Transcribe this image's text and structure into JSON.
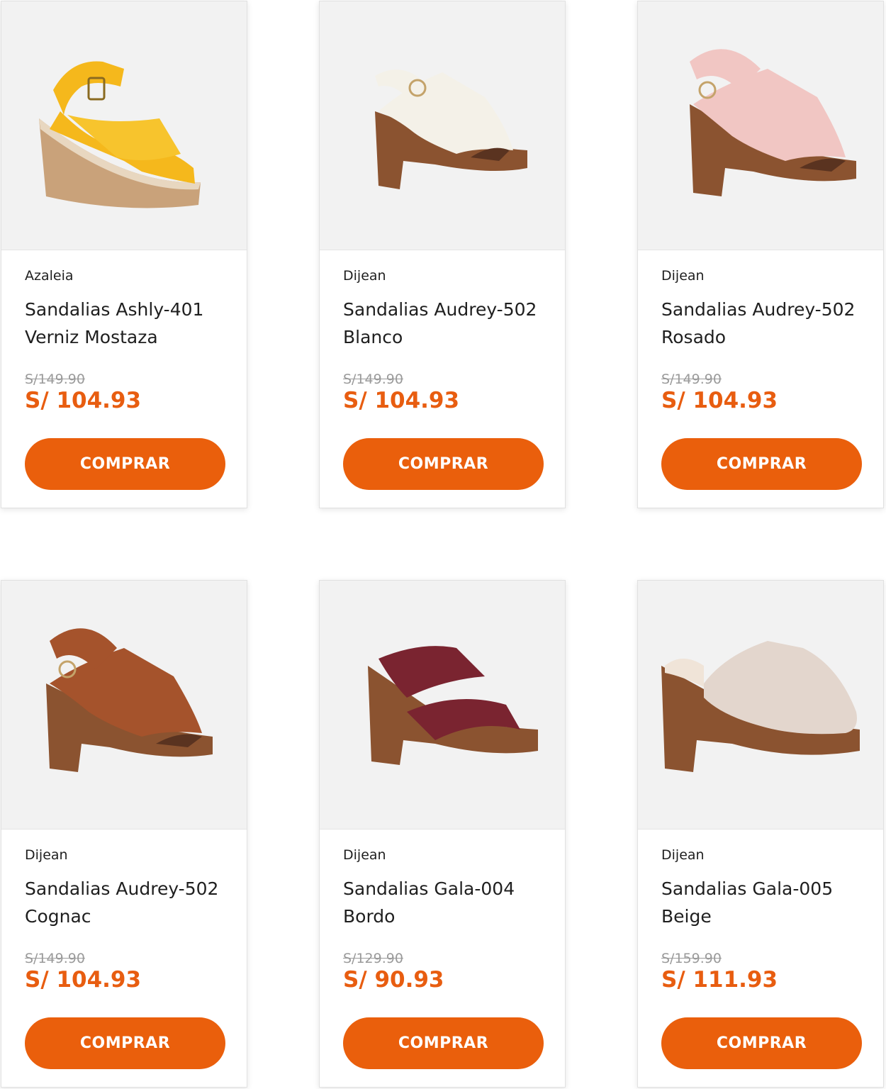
{
  "products": [
    {
      "brand": "Azaleia",
      "name": "Sandalias Ashly-401 Verniz Mostaza",
      "old_price": "S/149.90",
      "price": "S/ 104.93",
      "button": "COMPRAR",
      "color": "#f5b81c",
      "style": "wedge"
    },
    {
      "brand": "Dijean",
      "name": "Sandalias Audrey-502 Blanco",
      "old_price": "S/149.90",
      "price": "S/ 104.93",
      "button": "COMPRAR",
      "color": "#f4f1e8",
      "style": "clog-sling"
    },
    {
      "brand": "Dijean",
      "name": "Sandalias Audrey-502 Rosado",
      "old_price": "S/149.90",
      "price": "S/ 104.93",
      "button": "COMPRAR",
      "color": "#f1c6c3",
      "style": "clog-sling"
    },
    {
      "brand": "Dijean",
      "name": "Sandalias Audrey-502 Cognac",
      "old_price": "S/149.90",
      "price": "S/ 104.93",
      "button": "COMPRAR",
      "color": "#a5532c",
      "style": "clog-sling"
    },
    {
      "brand": "Dijean",
      "name": "Sandalias Gala-004 Bordo",
      "old_price": "S/129.90",
      "price": "S/ 90.93",
      "button": "COMPRAR",
      "color": "#7a2430",
      "style": "two-strap"
    },
    {
      "brand": "Dijean",
      "name": "Sandalias Gala-005 Beige",
      "old_price": "S/159.90",
      "price": "S/ 111.93",
      "button": "COMPRAR",
      "color": "#e3d6cd",
      "style": "mule"
    }
  ],
  "colors": {
    "accent": "#ea5f0c",
    "price": "#e85d10",
    "wood": "#8b5330"
  }
}
